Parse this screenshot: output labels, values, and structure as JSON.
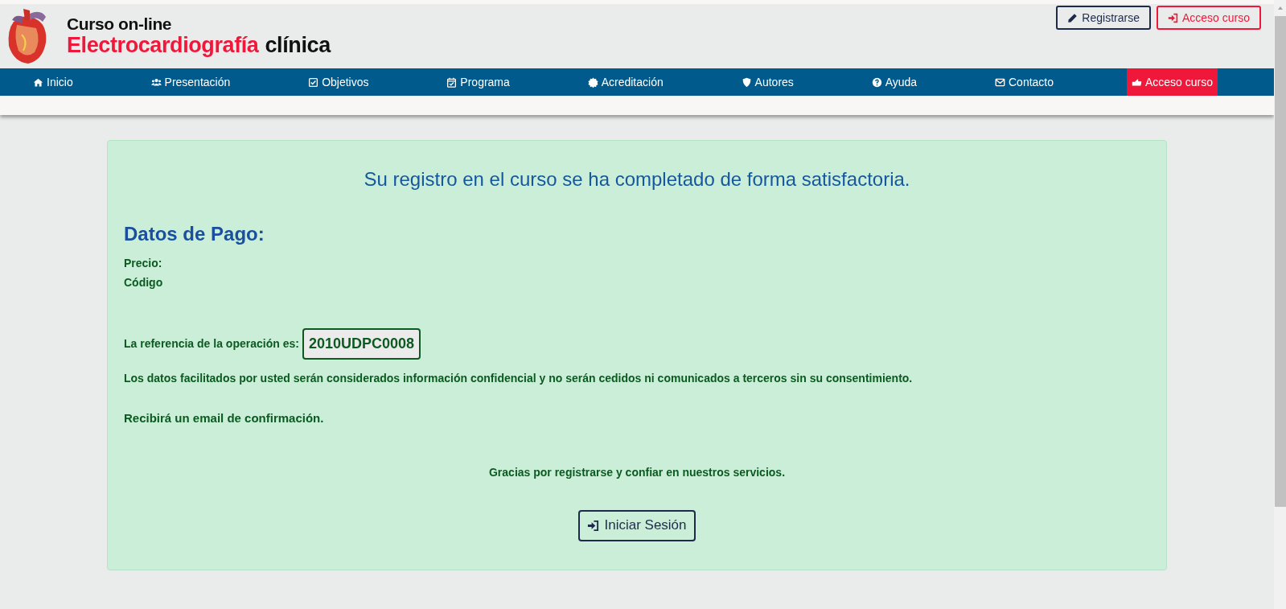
{
  "logo": {
    "line_1": "Curso on-line",
    "line_2_highlight": "Electrocardiografía",
    "line_2_rest": "clínica"
  },
  "header_buttons": [
    {
      "label": "Registrarse",
      "kind": "outline-dark"
    },
    {
      "label": "Acceso curso",
      "kind": "outline-red"
    }
  ],
  "nav": [
    {
      "label": "Inicio",
      "selected": false
    },
    {
      "label": "Presentación",
      "selected": false
    },
    {
      "label": "Objetivos",
      "selected": false
    },
    {
      "label": "Programa",
      "selected": false
    },
    {
      "label": "Acreditación",
      "selected": false
    },
    {
      "label": "Autores",
      "selected": false
    },
    {
      "label": "Ayuda",
      "selected": false
    },
    {
      "label": "Contacto",
      "selected": false
    },
    {
      "label": "Acceso curso",
      "selected": true
    }
  ],
  "card": {
    "title": "Su registro en el curso se ha completado de forma satisfactoria.",
    "heading": "Datos de Pago:",
    "fields": [
      "Precio:",
      "Código"
    ],
    "reference_label": "La referencia de la operación es:",
    "reference_value": "2010UDPC0008",
    "privacy_note": "Los datos facilitados por usted serán considerados información confidencial y no serán cedidos ni comunicados a terceros sin su consentimiento.",
    "email_note": "Recibirá un email de confirmación.",
    "thanks": "Gracias por registrarse y confiar en nuestros servicios.",
    "button": {
      "label": "Iniciar Sesión"
    }
  }
}
